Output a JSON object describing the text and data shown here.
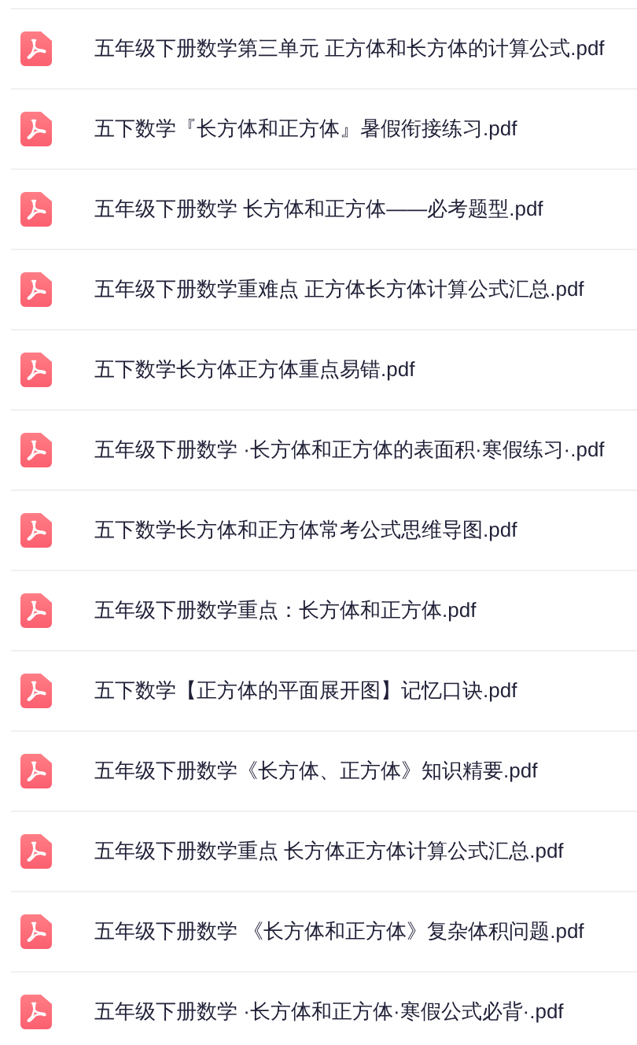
{
  "files": [
    {
      "name": "五年级下册数学第三单元 正方体和长方体的计算公式.pdf"
    },
    {
      "name": "五下数学『长方体和正方体』暑假衔接练习.pdf"
    },
    {
      "name": "五年级下册数学 长方体和正方体——必考题型.pdf"
    },
    {
      "name": "五年级下册数学重难点 正方体长方体计算公式汇总.pdf"
    },
    {
      "name": "五下数学长方体正方体重点易错.pdf"
    },
    {
      "name": "五年级下册数学 ·长方体和正方体的表面积·寒假练习·.pdf"
    },
    {
      "name": "五下数学长方体和正方体常考公式思维导图.pdf"
    },
    {
      "name": "五年级下册数学重点：长方体和正方体.pdf"
    },
    {
      "name": "五下数学【正方体的平面展开图】记忆口诀.pdf"
    },
    {
      "name": "五年级下册数学《长方体、正方体》知识精要.pdf"
    },
    {
      "name": "五年级下册数学重点 长方体正方体计算公式汇总.pdf"
    },
    {
      "name": "五年级下册数学 《长方体和正方体》复杂体积问题.pdf"
    },
    {
      "name": "五年级下册数学 ·长方体和正方体·寒假公式必背·.pdf"
    }
  ]
}
